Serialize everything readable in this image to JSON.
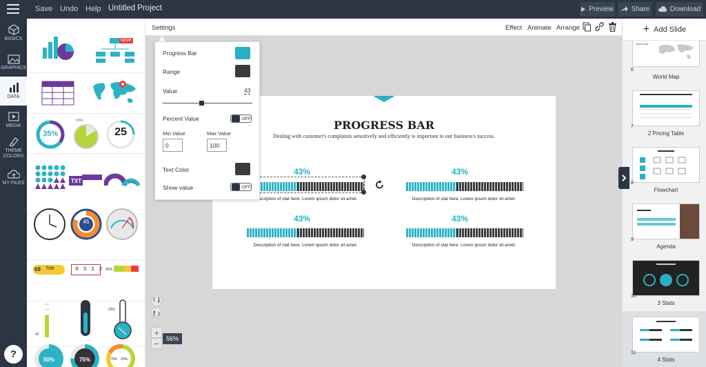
{
  "topbar": {
    "save": "Save",
    "undo": "Undo",
    "help": "Help",
    "project_title": "Untitled Project",
    "preview": "Preview",
    "share": "Share",
    "download": "Download"
  },
  "leftnav": {
    "items": [
      {
        "label": "BASICS",
        "icon": "basics-icon"
      },
      {
        "label": "GRAPHICS",
        "icon": "graphics-icon"
      },
      {
        "label": "DATA",
        "icon": "data-icon",
        "active": true
      },
      {
        "label": "MEDIA",
        "icon": "media-icon"
      },
      {
        "label": "THEME\nCOLORS",
        "icon": "theme-colors-icon"
      },
      {
        "label": "MY FILES",
        "icon": "my-files-icon"
      }
    ],
    "help": "?"
  },
  "widgets": {
    "new_badge": "NEW!",
    "donut1": "35%",
    "pie_label": "20%",
    "counter": "25",
    "txt_label": "TXT",
    "semi1": "63%",
    "semi2": "27%",
    "dial": "45",
    "rating_num": "68",
    "rating_title": "Title",
    "odometer": "0 3 1 2",
    "pct55": "55%",
    "thermo": "42",
    "thermo2": "25%",
    "d1": "50%",
    "d2": "75%",
    "d3a": "70%",
    "d3b": "20%"
  },
  "toolbar": {
    "settings": "Settings",
    "effect": "Effect",
    "animate": "Animate",
    "arrange": "Arrange"
  },
  "popover": {
    "progress_bar": "Progress Bar",
    "range": "Range",
    "value": "Value",
    "value_num": "43",
    "percent_value": "Percent Value",
    "off": "OFF",
    "min_value": "Min Value",
    "max_value": "Max Value",
    "min_num": "0",
    "max_num": "100",
    "text_color": "Text Color",
    "show_value": "Show value",
    "value_level": 0.43
  },
  "colors": {
    "accent": "#29b1c3",
    "bar_dark": "#3b3b3b",
    "nav_bg": "#2b3543"
  },
  "slide": {
    "title": "PROGRESS BAR",
    "subtitle": "Dealing with customer's complaints sensitively and efficiently is important to our business's success.",
    "stats": [
      {
        "pct": "43%",
        "desc": "Description of stat here. Lorem ipsum dolor sit amet.",
        "value": 0.43
      },
      {
        "pct": "43%",
        "desc": "Description of stat here. Lorem ipsum dolor sit amet.",
        "value": 0.43
      },
      {
        "pct": "43%",
        "desc": "Description of stat here. Lorem ipsum dolor sit amet.",
        "value": 0.43
      },
      {
        "pct": "43%",
        "desc": "Description of stat here. Lorem ipsum dolor sit amet.",
        "value": 0.43
      }
    ]
  },
  "zoom": {
    "plus": "+",
    "minus": "−",
    "level": "56%"
  },
  "rightpanel": {
    "add_slide": "Add Slide",
    "slides": [
      {
        "num": "6",
        "label": "World Map"
      },
      {
        "num": "7",
        "label": "2 Pricing Table"
      },
      {
        "num": "8",
        "label": "Flowchart"
      },
      {
        "num": "9",
        "label": "Agenda"
      },
      {
        "num": "10",
        "label": "3 Stats"
      },
      {
        "num": "11",
        "label": "4 Stats"
      }
    ]
  }
}
